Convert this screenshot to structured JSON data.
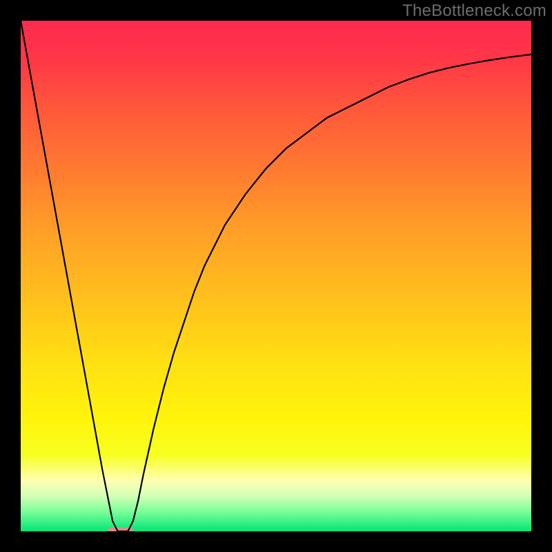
{
  "watermark": "TheBottleneck.com",
  "chart_data": {
    "type": "line",
    "title": "",
    "xlabel": "",
    "ylabel": "",
    "xlim": [
      0,
      100
    ],
    "ylim": [
      0,
      100
    ],
    "x": [
      0,
      2,
      4,
      6,
      8,
      10,
      12,
      14,
      16,
      17,
      18,
      19,
      20,
      21,
      22,
      23,
      24,
      26,
      28,
      30,
      32,
      34,
      36,
      38,
      40,
      44,
      48,
      52,
      56,
      60,
      64,
      68,
      72,
      76,
      80,
      84,
      88,
      92,
      96,
      100
    ],
    "values": [
      100,
      89,
      78,
      67,
      56,
      45,
      34,
      23,
      12,
      7,
      2,
      0,
      0,
      0,
      2,
      6,
      11,
      20,
      28,
      35,
      41,
      47,
      52,
      56,
      60,
      66,
      71,
      75,
      78,
      81,
      83,
      85,
      87,
      88.5,
      89.8,
      90.8,
      91.6,
      92.3,
      92.9,
      93.4
    ],
    "marker": {
      "x_range": [
        17,
        22
      ],
      "y": 0,
      "color": "#e08a8a"
    },
    "curve_stroke": "#000000",
    "gradient_stops": [
      {
        "offset": 0.0,
        "color": "#ff2a4d"
      },
      {
        "offset": 0.07,
        "color": "#ff3548"
      },
      {
        "offset": 0.18,
        "color": "#ff5a3a"
      },
      {
        "offset": 0.3,
        "color": "#ff7d30"
      },
      {
        "offset": 0.42,
        "color": "#ffa126"
      },
      {
        "offset": 0.55,
        "color": "#ffc21c"
      },
      {
        "offset": 0.67,
        "color": "#ffe013"
      },
      {
        "offset": 0.78,
        "color": "#fff40a"
      },
      {
        "offset": 0.85,
        "color": "#f7ff20"
      },
      {
        "offset": 0.9,
        "color": "#ffffb0"
      },
      {
        "offset": 0.93,
        "color": "#d4ffb8"
      },
      {
        "offset": 0.96,
        "color": "#80ff9a"
      },
      {
        "offset": 1.0,
        "color": "#00e676"
      }
    ]
  }
}
